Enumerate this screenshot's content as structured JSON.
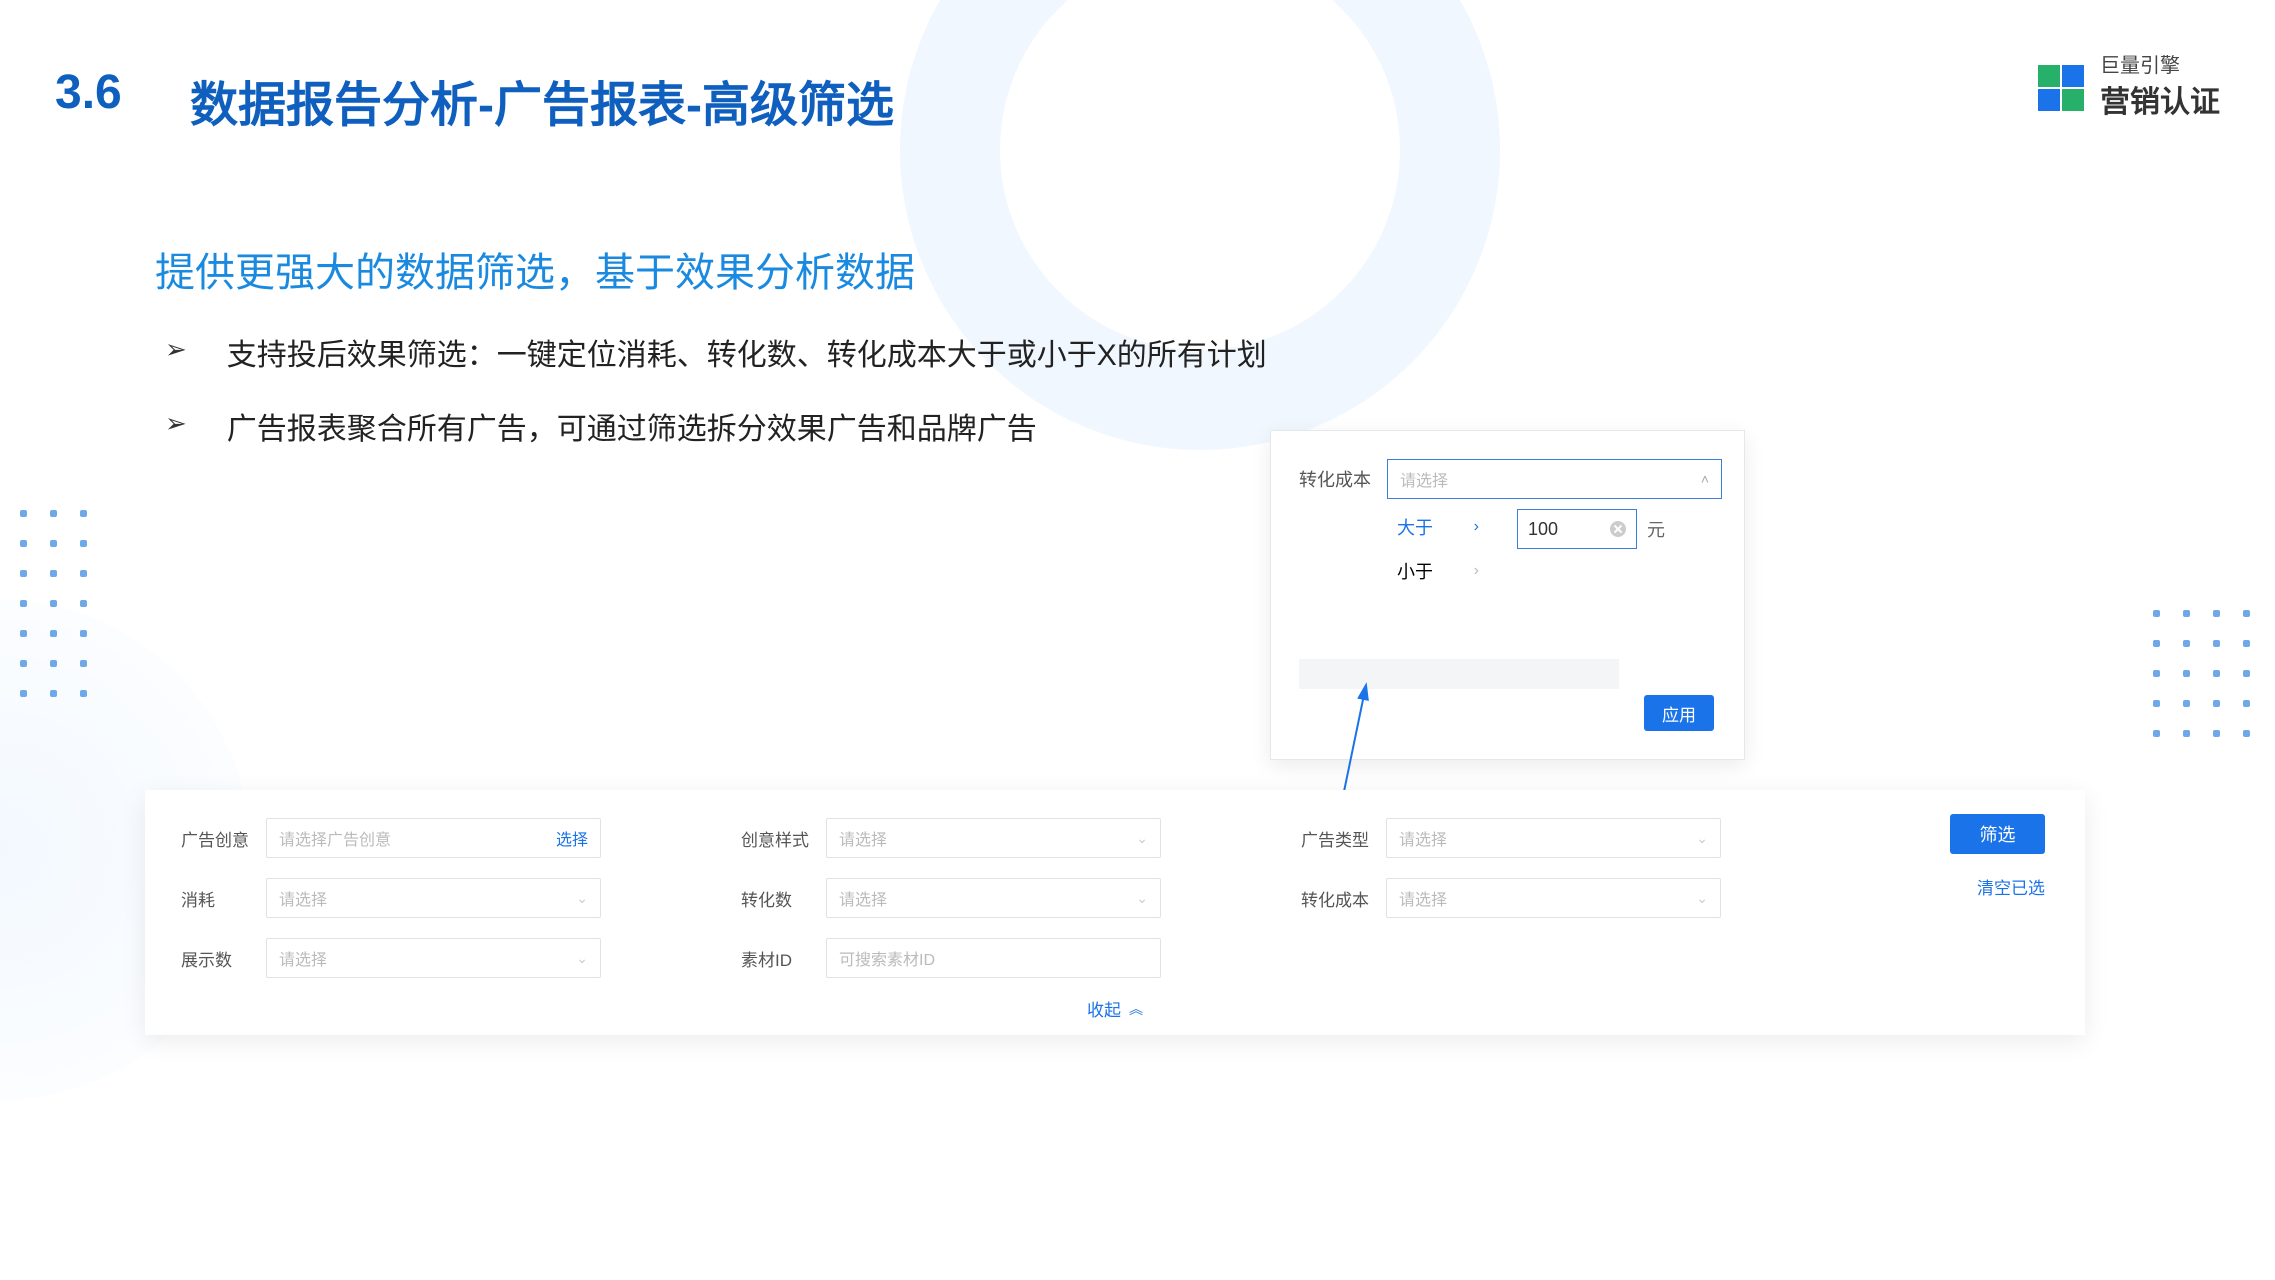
{
  "header": {
    "number": "3.6",
    "title": "数据报告分析-广告报表-高级筛选",
    "logo_small": "巨量引擎",
    "logo_big": "营销认证"
  },
  "subtitle": "提供更强大的数据筛选，基于效果分析数据",
  "bullets": [
    "支持投后效果筛选：一键定位消耗、转化数、转化成本大于或小于X的所有计划",
    "广告报表聚合所有广告，可通过筛选拆分效果广告和品牌广告"
  ],
  "popup": {
    "label": "转化成本",
    "select_placeholder": "请选择",
    "options": [
      "大于",
      "小于"
    ],
    "value": "100",
    "unit": "元",
    "apply": "应用"
  },
  "filters": {
    "row1": [
      {
        "label": "广告创意",
        "placeholder": "请选择广告创意",
        "action": "选择",
        "type": "picker"
      },
      {
        "label": "创意样式",
        "placeholder": "请选择",
        "type": "select"
      },
      {
        "label": "广告类型",
        "placeholder": "请选择",
        "type": "select"
      }
    ],
    "row2": [
      {
        "label": "消耗",
        "placeholder": "请选择",
        "type": "select"
      },
      {
        "label": "转化数",
        "placeholder": "请选择",
        "type": "select"
      },
      {
        "label": "转化成本",
        "placeholder": "请选择",
        "type": "select"
      }
    ],
    "row3": [
      {
        "label": "展示数",
        "placeholder": "请选择",
        "type": "select"
      },
      {
        "label": "素材ID",
        "placeholder": "可搜索素材ID",
        "type": "text"
      }
    ],
    "primary_button": "筛选",
    "clear_link": "清空已选",
    "collapse": "收起"
  }
}
